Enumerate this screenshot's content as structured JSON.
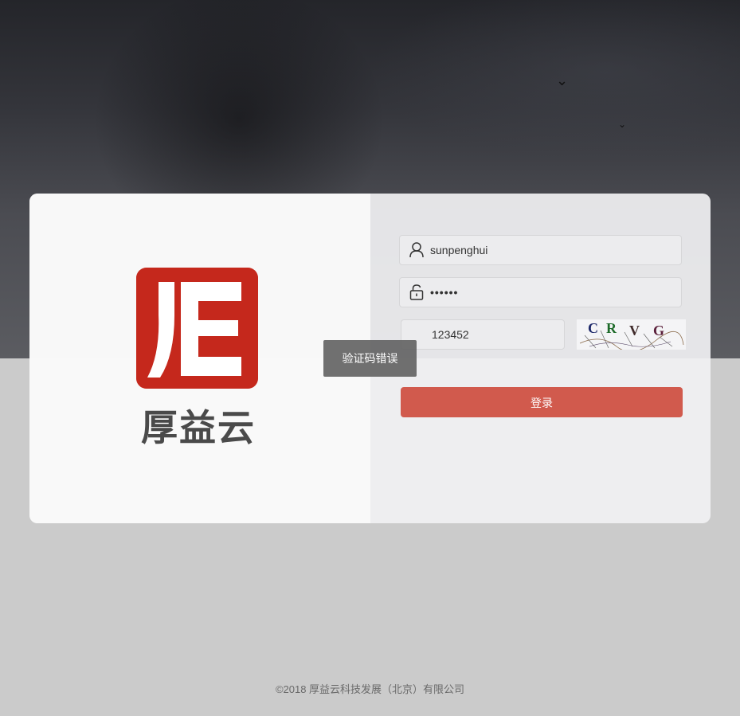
{
  "brand": {
    "logo_text": "厚益云",
    "logo_mark_color": "#c5281c",
    "logo_icon": "hyc-logo-icon"
  },
  "login": {
    "username": {
      "value": "sunpenghui",
      "icon": "user-icon"
    },
    "password": {
      "value": "••••••",
      "icon": "lock-icon"
    },
    "captcha": {
      "value": "123452",
      "image_text": "CRVG"
    },
    "submit_label": "登录",
    "accent_color": "#d15a4d"
  },
  "toast": {
    "message": "验证码错误"
  },
  "footer": {
    "text": "©2018  厚益云科技发展（北京）有限公司"
  }
}
